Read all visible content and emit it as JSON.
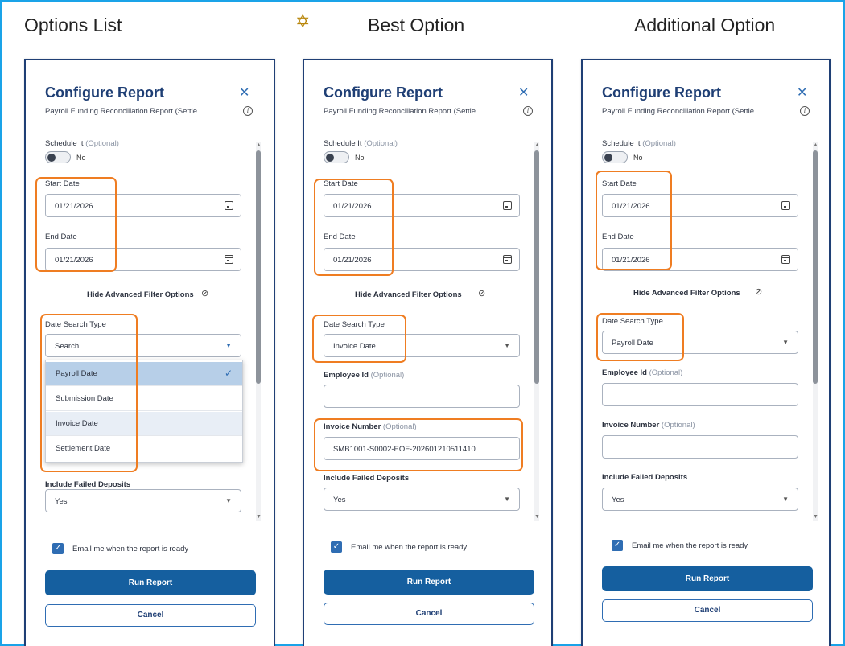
{
  "headings": {
    "options_list": "Options List",
    "best_option": "Best Option",
    "additional_option": "Additional Option",
    "star_icon": "star-icon"
  },
  "panel": {
    "title": "Configure Report",
    "subtitle": "Payroll Funding Reconciliation Report (Settle...",
    "schedule_label": "Schedule It",
    "optional": "(Optional)",
    "toggle_value": "No",
    "start_date_label": "Start Date",
    "start_date_value": "01/21/2026",
    "end_date_label": "End Date",
    "end_date_value": "01/21/2026",
    "advanced_toggle": "Hide Advanced Filter Options",
    "date_search_type_label": "Date Search Type",
    "employee_id_label": "Employee Id",
    "invoice_number_label": "Invoice Number",
    "include_failed_label": "Include Failed Deposits",
    "include_failed_value": "Yes",
    "email_checkbox_label": "Email me when the report is ready",
    "run_button": "Run Report",
    "cancel_button": "Cancel"
  },
  "panel1": {
    "date_search_type_value": "Search",
    "dropdown_options": [
      "Payroll Date",
      "Submission Date",
      "Invoice Date",
      "Settlement Date"
    ],
    "selected_option": "Payroll Date"
  },
  "panel2": {
    "date_search_type_value": "Invoice Date",
    "invoice_number_value": "SMB1001-S0002-EOF-202601210511410"
  },
  "panel3": {
    "date_search_type_value": "Payroll Date"
  },
  "colors": {
    "frame_border": "#1aa3e8",
    "highlight": "#ef7d22",
    "primary_button": "#155f9f",
    "title": "#1f3f75"
  }
}
